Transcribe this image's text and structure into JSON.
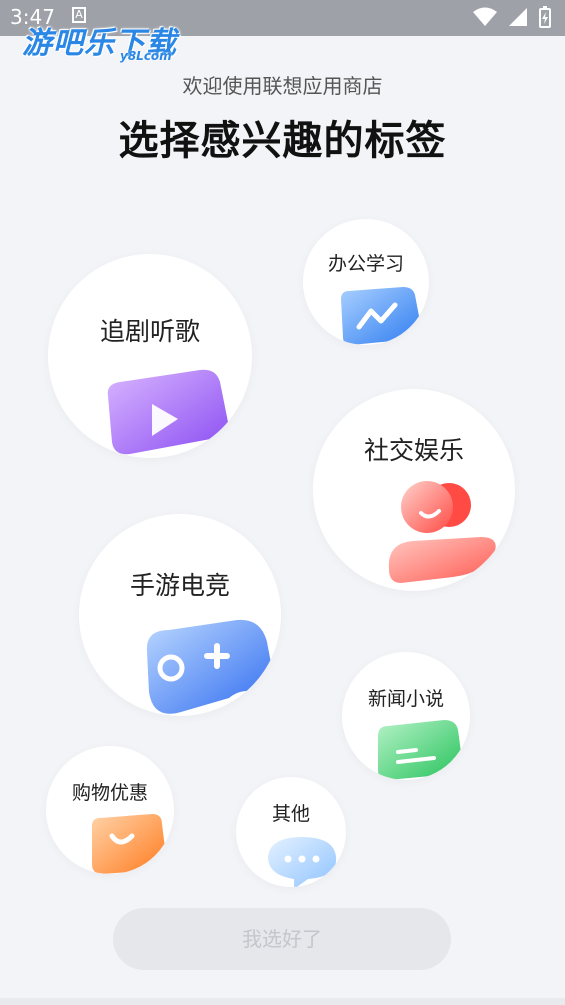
{
  "status": {
    "time": "3:47",
    "notif": "A"
  },
  "watermark": {
    "text": "游吧乐下载",
    "sub": "y8Lcom"
  },
  "header": {
    "welcome": "欢迎使用联想应用商店",
    "title": "选择感兴趣的标签"
  },
  "tags": [
    {
      "label": "追剧听歌",
      "icon": "video-play-icon"
    },
    {
      "label": "办公学习",
      "icon": "chart-folder-icon"
    },
    {
      "label": "社交娱乐",
      "icon": "people-icon"
    },
    {
      "label": "手游电竞",
      "icon": "gamepad-icon"
    },
    {
      "label": "新闻小说",
      "icon": "news-icon"
    },
    {
      "label": "购物优惠",
      "icon": "shopping-bag-icon"
    },
    {
      "label": "其他",
      "icon": "chat-bubble-icon"
    }
  ],
  "confirm_label": "我选好了",
  "colors": {
    "background": "#f3f4f8",
    "button_bg": "#e6e7eb",
    "button_text": "#c4c6cc"
  }
}
